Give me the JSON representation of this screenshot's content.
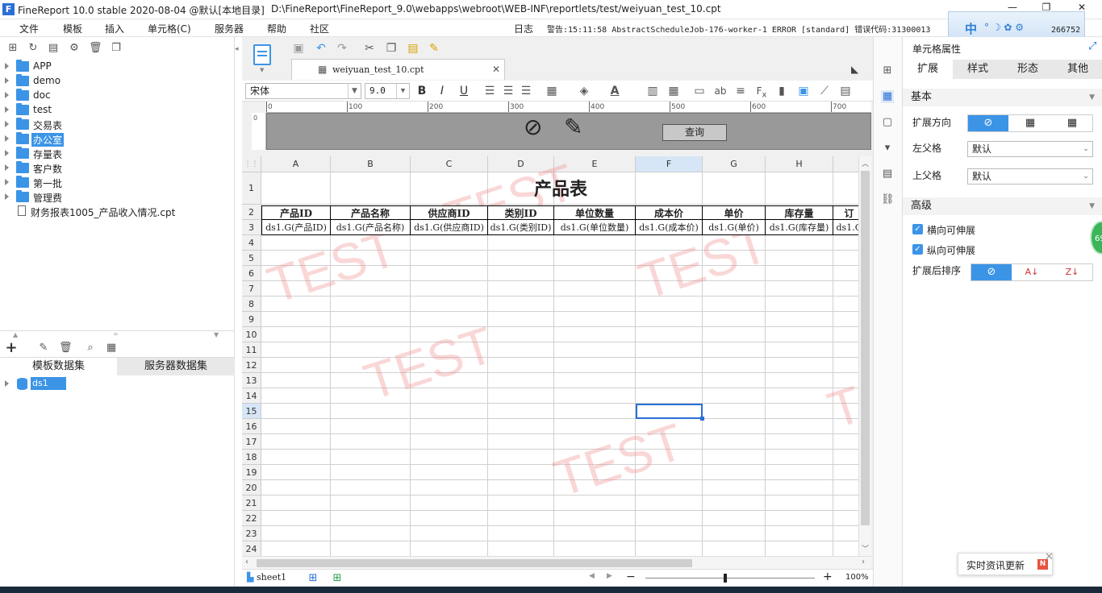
{
  "window": {
    "title": "FineReport 10.0 stable 2020-08-04 @默认[本地目录]",
    "path": "D:\\FineReport\\FineReport_9.0\\webapps\\webroot\\WEB-INF\\reportlets/test/weiyuan_test_10.cpt",
    "minimize": "—",
    "restore": "❐",
    "close": "✕"
  },
  "menu": [
    "文件",
    "模板",
    "插入",
    "单元格(C)",
    "服务器",
    "帮助",
    "社区"
  ],
  "status": {
    "log": "日志",
    "warning": "警告:15:11:58 AbstractScheduleJob-176-worker-1 ERROR [standard] 错误代码:31300013",
    "code_tail": "266752"
  },
  "ime": {
    "lang": "中"
  },
  "tree": [
    {
      "label": "APP",
      "type": "folder"
    },
    {
      "label": "demo",
      "type": "folder"
    },
    {
      "label": "doc",
      "type": "folder"
    },
    {
      "label": "test",
      "type": "folder"
    },
    {
      "label": "交易表",
      "type": "folder"
    },
    {
      "label": "办公室",
      "type": "folder",
      "selected": true
    },
    {
      "label": "存量表",
      "type": "folder"
    },
    {
      "label": "客户数",
      "type": "folder"
    },
    {
      "label": "第一批",
      "type": "folder"
    },
    {
      "label": "管理费",
      "type": "folder"
    },
    {
      "label": "财务报表1005_产品收入情况.cpt",
      "type": "file"
    }
  ],
  "datasets": {
    "tab_template": "模板数据集",
    "tab_server": "服务器数据集",
    "items": [
      "ds1"
    ]
  },
  "editor": {
    "file_tab": "weiyuan_test_10.cpt",
    "font": "宋体",
    "font_size": "9.0",
    "query_button": "查询",
    "sheet": "sheet1",
    "zoom": "100%"
  },
  "ruler": [
    "0",
    "100",
    "200",
    "300",
    "400",
    "500",
    "600",
    "700"
  ],
  "columns": [
    "A",
    "B",
    "C",
    "D",
    "E",
    "F",
    "G",
    "H"
  ],
  "rows": [
    "1",
    "2",
    "3",
    "4",
    "5",
    "6",
    "7",
    "8",
    "9",
    "10",
    "11",
    "12",
    "13",
    "14",
    "15",
    "16",
    "17",
    "18",
    "19",
    "20",
    "21",
    "22",
    "23",
    "24"
  ],
  "report": {
    "title": "产品表",
    "headers": [
      "产品ID",
      "产品名称",
      "供应商ID",
      "类别ID",
      "单位数量",
      "成本价",
      "单价",
      "库存量",
      "订"
    ],
    "cells": [
      "ds1.G(产品ID)",
      "ds1.G(产品名称)",
      "ds1.G(供应商ID)",
      "ds1.G(类别ID)",
      "ds1.G(单位数量)",
      "ds1.G(成本价)",
      "ds1.G(单价)",
      "ds1.G(库存量)",
      "ds1.G"
    ],
    "watermark": "TEST"
  },
  "props": {
    "title": "单元格属性",
    "tabs": [
      "扩展",
      "样式",
      "形态",
      "其他"
    ],
    "basic": "基本",
    "expand_dir": "扩展方向",
    "left_parent": "左父格",
    "left_parent_val": "默认",
    "up_parent": "上父格",
    "up_parent_val": "默认",
    "advanced": "高级",
    "h_expand": "横向可伸展",
    "v_expand": "纵向可伸展",
    "sort_after": "扩展后排序"
  },
  "badge": {
    "text": "69"
  },
  "news": {
    "label": "实时资讯更新",
    "icon": "N"
  }
}
